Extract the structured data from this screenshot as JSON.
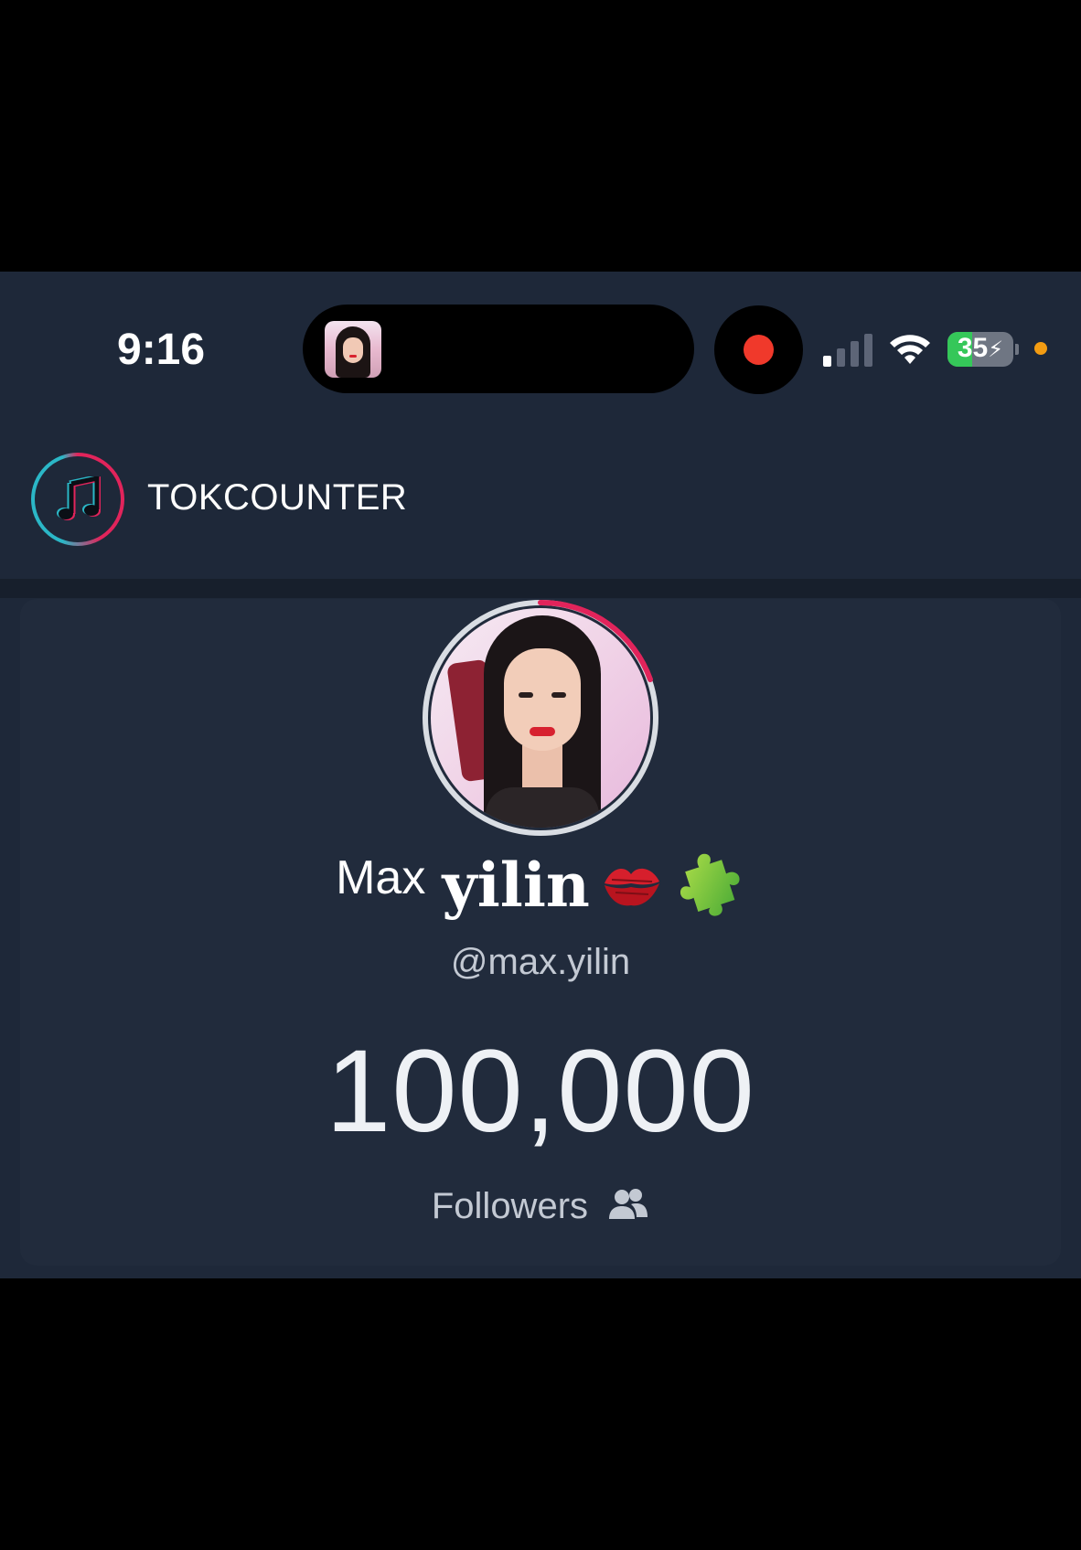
{
  "status_bar": {
    "time": "9:16",
    "battery_level": "35",
    "signal_bars_active": 1,
    "signal_bars_total": 4,
    "recording": true,
    "colors": {
      "recording": "#f0392b",
      "battery": "#35c759",
      "privacy_dot": "#f39c12"
    }
  },
  "header": {
    "app_title": "TOKCOUNTER",
    "logo_icon": "music-note-icon"
  },
  "profile": {
    "display_name_first": "Max",
    "display_name_last": "yilin",
    "display_name_emojis": [
      "kiss-mark-icon",
      "puzzle-piece-icon"
    ],
    "handle": "@max.yilin",
    "follower_count": "100,000",
    "followers_label": "Followers",
    "followers_icon": "people-icon",
    "avatar_ring_color": "#e1245b"
  }
}
